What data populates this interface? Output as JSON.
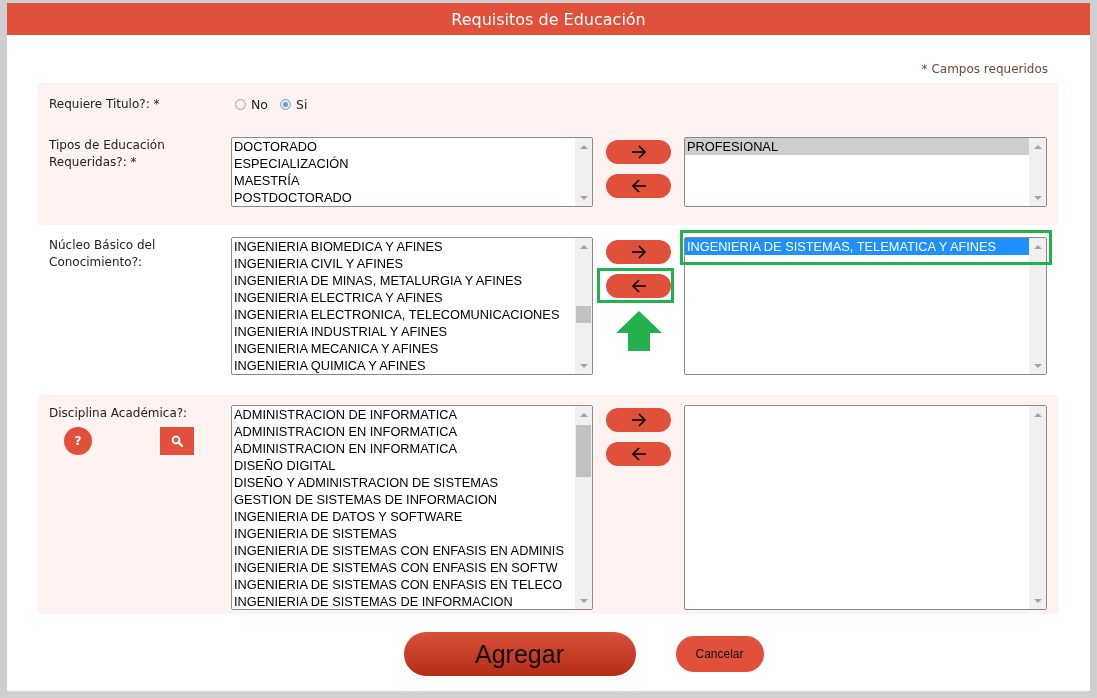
{
  "title": "Requisitos de Educación",
  "required_note": "* Campos requeridos",
  "fields": [
    {
      "kind": "radio",
      "shaded": true,
      "label": "Requiere Titulo?: *",
      "options": [
        {
          "label": "No",
          "selected": false
        },
        {
          "label": "Si",
          "selected": true
        }
      ]
    },
    {
      "kind": "transfer",
      "shaded": true,
      "label": "Tipos de Educación Requeridas?: *",
      "available": [
        "DOCTORADO",
        "ESPECIALIZACIÓN",
        "MAESTRÍA",
        "POSTDOCTORADO"
      ],
      "buttons": [
        {
          "kind": "right",
          "annotated": false
        },
        {
          "kind": "left",
          "annotated": false
        }
      ],
      "chosen": {
        "focused": false,
        "items": [
          {
            "text": "PROFESIONAL",
            "selected": true,
            "annotated": false
          }
        ]
      }
    },
    {
      "kind": "transfer",
      "shaded": false,
      "label": "Núcleo Básico del Conocimiento?:",
      "available": [
        "INGENIERIA BIOMEDICA Y AFINES",
        "INGENIERIA CIVIL Y AFINES",
        "INGENIERIA DE MINAS, METALURGIA Y AFINES",
        "INGENIERIA ELECTRICA Y AFINES",
        "INGENIERIA ELECTRONICA, TELECOMUNICACIONES",
        "INGENIERIA INDUSTRIAL Y AFINES",
        "INGENIERIA MECANICA Y AFINES",
        "INGENIERIA QUIMICA Y AFINES"
      ],
      "buttons": [
        {
          "kind": "right",
          "annotated": false
        },
        {
          "kind": "left",
          "annotated": true
        }
      ],
      "chosen": {
        "focused": true,
        "items": [
          {
            "text": "INGENIERIA DE SISTEMAS, TELEMATICA Y AFINES",
            "selected": true,
            "annotated": true
          }
        ]
      }
    },
    {
      "kind": "transfer",
      "shaded": true,
      "label": "Disciplina Académica?:",
      "help_label": "?",
      "search": true,
      "available": [
        "ADMINISTRACION DE INFORMATICA",
        "ADMINISTRACION EN INFORMATICA",
        "ADMINISTRACION EN INFORMATICA",
        "DISEÑO DIGITAL",
        "DISEÑO Y ADMINISTRACION DE SISTEMAS",
        "GESTION DE SISTEMAS DE INFORMACION",
        "INGENIERIA DE DATOS Y SOFTWARE",
        "INGENIERIA DE SISTEMAS",
        "INGENIERIA DE SISTEMAS CON ENFASIS EN ADMINIS",
        "INGENIERIA DE SISTEMAS CON ENFASIS EN SOFTW",
        "INGENIERIA DE SISTEMAS CON ENFASIS EN TELECO",
        "INGENIERIA DE SISTEMAS DE INFORMACION"
      ],
      "buttons": [
        {
          "kind": "right",
          "annotated": false
        },
        {
          "kind": "left",
          "annotated": false
        }
      ]
    }
  ],
  "actions": [
    {
      "kind": "primary",
      "label": "Agregar"
    },
    {
      "kind": "secondary",
      "label": "Cancelar"
    }
  ]
}
